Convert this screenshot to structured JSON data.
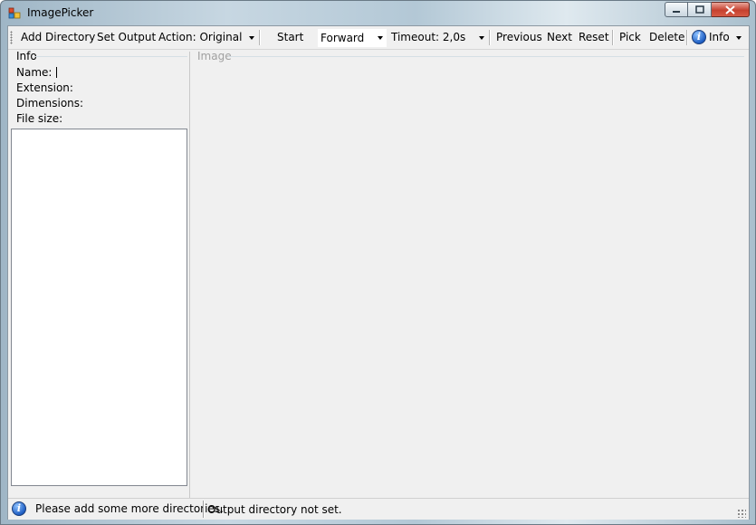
{
  "window": {
    "title": "ImagePicker",
    "controls": {
      "minimize": "minimize",
      "maximize": "maximize",
      "close": "close"
    }
  },
  "toolbar": {
    "add_directory": "Add Directory",
    "set_output": "Set Output",
    "action_label": "Action: Original",
    "start": "Start",
    "direction_value": "Forward",
    "timeout_label": "Timeout: 2,0s",
    "previous": "Previous",
    "next": "Next",
    "reset": "Reset",
    "pick": "Pick",
    "delete": "Delete",
    "info": "Info"
  },
  "info_panel": {
    "group_label": "Info",
    "name_label": "Name:",
    "extension_label": "Extension:",
    "dimensions_label": "Dimensions:",
    "file_size_label": "File size:"
  },
  "image_panel": {
    "group_label": "Image"
  },
  "statusbar": {
    "message": "Please add some more directories.",
    "output_status": "Output directory not set."
  },
  "icons": {
    "app": "image-picker-app-icon",
    "info": "info-icon",
    "status": "info-icon"
  }
}
